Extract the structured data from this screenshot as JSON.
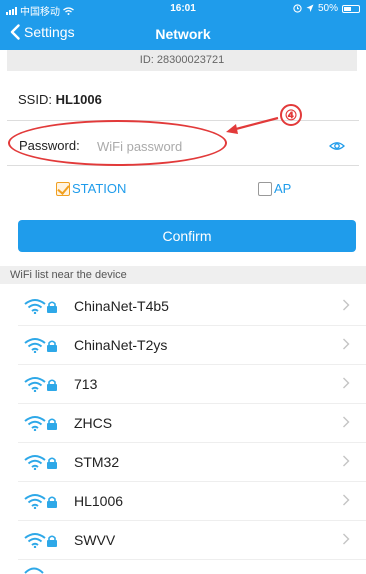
{
  "status_bar": {
    "carrier": "中国移动",
    "time": "16:01",
    "battery": "50%"
  },
  "nav": {
    "back_label": "Settings",
    "title": "Network"
  },
  "device_id": "ID: 28300023721",
  "ssid": {
    "label": "SSID:",
    "value": "HL1006"
  },
  "password": {
    "label": "Password:",
    "placeholder": "WiFi password"
  },
  "annotation": {
    "number": "④"
  },
  "mode": {
    "station": {
      "label": "STATION",
      "checked": true
    },
    "ap": {
      "label": "AP",
      "checked": false
    }
  },
  "confirm_label": "Confirm",
  "wifi_list": {
    "header": "WiFi list near the device",
    "networks": [
      {
        "name": "ChinaNet-T4b5"
      },
      {
        "name": "ChinaNet-T2ys"
      },
      {
        "name": "713"
      },
      {
        "name": "ZHCS"
      },
      {
        "name": "STM32"
      },
      {
        "name": "HL1006"
      },
      {
        "name": "SWVV"
      }
    ]
  },
  "colors": {
    "accent": "#1f9ceb",
    "annotation": "#e23a3a",
    "checkbox": "#f0a021"
  }
}
